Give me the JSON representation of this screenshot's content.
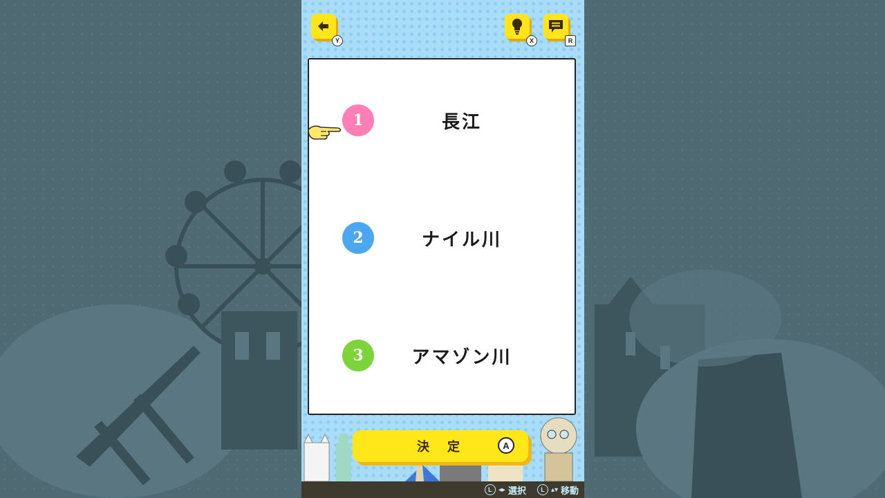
{
  "header": {
    "back_button": {
      "icon": "arrow-left-icon",
      "key": "Y"
    },
    "hint_button": {
      "icon": "lightbulb-icon",
      "key": "X"
    },
    "log_button": {
      "icon": "message-icon",
      "key": "R"
    }
  },
  "options": [
    {
      "number": "1",
      "label": "長江",
      "color": "#ff7eb3"
    },
    {
      "number": "2",
      "label": "ナイル川",
      "color": "#4ba7f0"
    },
    {
      "number": "3",
      "label": "アマゾン川",
      "color": "#7dd43a"
    }
  ],
  "selected_index": 0,
  "confirm": {
    "label": "決定",
    "key": "A"
  },
  "footer": {
    "select_hint": {
      "key": "L",
      "arrows": "◂▸",
      "label": "選択"
    },
    "move_hint": {
      "key": "L",
      "arrows": "▴▾",
      "label": "移動"
    }
  },
  "colors": {
    "accent_yellow": "#ffe71a",
    "panel_blue": "#a9dcf7",
    "background": "#4f6a73"
  }
}
